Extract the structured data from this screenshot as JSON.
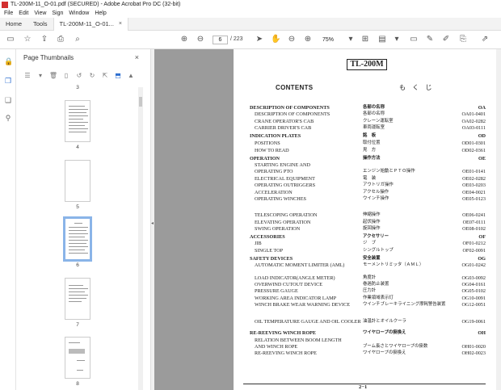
{
  "window": {
    "title": "TL-200M-11_O-01.pdf (SECURED) - Adobe Acrobat Pro DC (32-bit)"
  },
  "menu": [
    "File",
    "Edit",
    "View",
    "Sign",
    "Window",
    "Help"
  ],
  "tabs": [
    {
      "label": "Home"
    },
    {
      "label": "Tools"
    },
    {
      "label": "TL-200M-11_O-01...",
      "close": "×"
    }
  ],
  "toolbar": {
    "current_page": "6",
    "total_pages": "/ 223",
    "zoom": "75%"
  },
  "panel": {
    "title": "Page Thumbnails",
    "close": "×",
    "thumbnails": [
      {
        "number": "3"
      },
      {
        "number": "4"
      },
      {
        "number": "5"
      },
      {
        "number": "6",
        "selected": true
      },
      {
        "number": "7"
      },
      {
        "number": "8"
      }
    ]
  },
  "document": {
    "model": "TL-200M",
    "contents_title": "CONTENTS",
    "contents_jp": "も く じ",
    "footer": "2−1",
    "toc": [
      {
        "en": "DESCRIPTION OF COMPONENTS",
        "jp": "各部の名称",
        "code": "OA",
        "kind": "section"
      },
      {
        "en": "DESCRIPTION OF COMPONENTS",
        "jp": "各部の名称",
        "code": "OA01-0401",
        "kind": "item"
      },
      {
        "en": "CRANE OPERATOR'S CAB",
        "jp": "クレーン運転室",
        "code": "OA02-0282",
        "kind": "item"
      },
      {
        "en": "CARRIER DRIVER'S CAB",
        "jp": "車両運転室",
        "code": "OA03-0111",
        "kind": "item"
      },
      {
        "en": "INDICATION PLATES",
        "jp": "銘　板",
        "code": "OD",
        "kind": "section"
      },
      {
        "en": "POSITIONS",
        "jp": "取付位置",
        "code": "OD01-0301",
        "kind": "item"
      },
      {
        "en": "HOW TO READ",
        "jp": "見　方",
        "code": "OD02-0361",
        "kind": "item"
      },
      {
        "en": "OPERATION",
        "jp": "操作方法",
        "code": "OE",
        "kind": "section"
      },
      {
        "en": "STARTING ENGINE AND",
        "jp": "",
        "code": "",
        "kind": "item"
      },
      {
        "en": "OPERATING PTO",
        "jp": "エンジン始動とＰＴＯ操作",
        "code": "OE01-0141",
        "kind": "item"
      },
      {
        "en": "ELECTRICAL EQUIPMENT",
        "jp": "電　装",
        "code": "OE02-0282",
        "kind": "item"
      },
      {
        "en": "OPERATING OUTRIGGERS",
        "jp": "アウトリガ操作",
        "code": "OE03-0203",
        "kind": "item"
      },
      {
        "en": "ACCELERATION",
        "jp": "アクセル操作",
        "code": "OE04-0021",
        "kind": "item"
      },
      {
        "en": "OPERATING WINCHES",
        "jp": "ウインチ操作",
        "code": "OE05-0123",
        "kind": "item"
      },
      {
        "en": "TELESCOPING OPERATION",
        "jp": "伸縮操作",
        "code": "OE06-0241",
        "kind": "item"
      },
      {
        "en": "ELEVATING OPERATION",
        "jp": "起伏操作",
        "code": "OE07-0111",
        "kind": "item"
      },
      {
        "en": "SWING OPERATION",
        "jp": "旋回操作",
        "code": "OE08-0102",
        "kind": "item"
      },
      {
        "en": "ACCESSORIES",
        "jp": "アクセサリー",
        "code": "OF",
        "kind": "section"
      },
      {
        "en": "JIB",
        "jp": "ジ　ブ",
        "code": "OF01-0212",
        "kind": "item"
      },
      {
        "en": "SINGLE TOP",
        "jp": "シングルトップ",
        "code": "OF02-0091",
        "kind": "item"
      },
      {
        "en": "SAFETY DEVICES",
        "jp": "安全装置",
        "code": "OG",
        "kind": "section"
      },
      {
        "en": "AUTOMATIC MOMENT LIMITER (AML)",
        "jp": "モーメントリミッタ（ＡＭＬ）",
        "code": "OG01-0242",
        "kind": "item"
      },
      {
        "en": "LOAD INDICATOR(ANGLE METER)",
        "jp": "角度計",
        "code": "OG03-0092",
        "kind": "item"
      },
      {
        "en": "OVERWIND CUTOUT DEVICE",
        "jp": "巻過防止装置",
        "code": "OG04-0161",
        "kind": "item"
      },
      {
        "en": "PRESSURE GAUGE",
        "jp": "圧力計",
        "code": "OG05-0102",
        "kind": "item"
      },
      {
        "en": "WORKING AREA INDICATOR LAMP",
        "jp": "作業領域表示灯",
        "code": "OG10-0091",
        "kind": "item"
      },
      {
        "en": "WINCH BRAKE WEAR WARNING DEVICE",
        "jp": "ウインチブレーキライニング摩耗警告装置",
        "code": "OG12-0051",
        "kind": "item"
      },
      {
        "en": "OIL TEMPERATURE GAUGE AND OIL COOLER",
        "jp": "油温計とオイルクーラ",
        "code": "OG19-0061",
        "kind": "item"
      },
      {
        "en": "RE-REEVING WINCH ROPE",
        "jp": "ワイヤロープの掛換え",
        "code": "OH",
        "kind": "section"
      },
      {
        "en": "RELATION BETWEEN BOOM LENGTH",
        "jp": "",
        "code": "",
        "kind": "item"
      },
      {
        "en": "AND WINCH ROPE",
        "jp": "ブーム長さとワイヤロープの掛数",
        "code": "OH01-0020",
        "kind": "item"
      },
      {
        "en": "RE-REEVING WINCH ROPE",
        "jp": "ワイヤロープの掛換え",
        "code": "OH02-0023",
        "kind": "item"
      }
    ]
  }
}
